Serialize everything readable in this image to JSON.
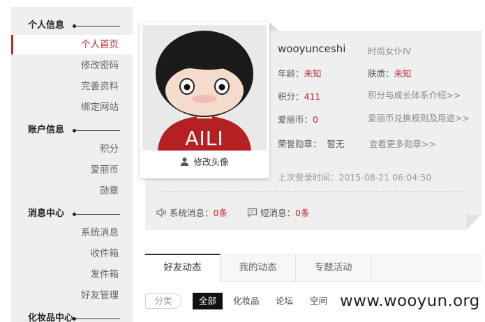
{
  "sidebar": {
    "sections": [
      {
        "title": "个人信息",
        "items": [
          {
            "label": "个人首页",
            "active": true
          },
          {
            "label": "修改密码"
          },
          {
            "label": "完善资料"
          },
          {
            "label": "绑定网站"
          }
        ]
      },
      {
        "title": "账户信息",
        "items": [
          {
            "label": "积分"
          },
          {
            "label": "爱丽币"
          },
          {
            "label": "勋章"
          }
        ]
      },
      {
        "title": "消息中心",
        "items": [
          {
            "label": "系统消息"
          },
          {
            "label": "收件箱"
          },
          {
            "label": "发件箱"
          },
          {
            "label": "好友管理"
          }
        ]
      },
      {
        "title": "化妆品中心",
        "items": []
      }
    ]
  },
  "profile": {
    "avatar_text": "AILI",
    "edit_avatar": "修改头像",
    "username": "wooyunceshi",
    "title": "时尚女仆IV",
    "age_label": "年龄：",
    "age_value": "未知",
    "skin_label": "肤质：",
    "skin_value": "未知",
    "points_label": "积分：",
    "points_value": "411",
    "coins_label": "爱丽币：",
    "coins_value": "0",
    "medal_label": "荣誉勋章：",
    "medal_value": "暂无",
    "link_points": "积分与成长体系介绍>>",
    "link_coins": "爱丽币兑换规则及用途>>",
    "link_medals": "查看更多勋章>>",
    "last_login": "上次登录时间：2015-08-21 06:04:50",
    "sys_msg_label": "系统消息：",
    "sys_msg_value": "0条",
    "short_msg_label": "短消息：",
    "short_msg_value": "0条"
  },
  "tabs": [
    "好友动态",
    "我的动态",
    "专题活动"
  ],
  "filters": {
    "label": "分类",
    "items": [
      "全部",
      "化妆品",
      "论坛",
      "空间"
    ]
  },
  "watermark": "www.wooyun.org",
  "colors": {
    "accent": "#c1262c",
    "sidebar_bg": "#efefef"
  }
}
